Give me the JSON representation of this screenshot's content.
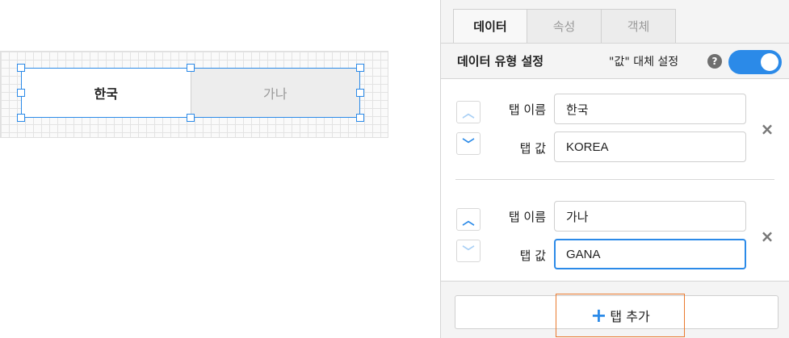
{
  "preview": {
    "tabs": [
      {
        "label": "한국",
        "state": "active"
      },
      {
        "label": "가나",
        "state": "inactive"
      }
    ]
  },
  "panel": {
    "tabs": [
      {
        "label": "데이터",
        "active": true
      },
      {
        "label": "속성",
        "active": false
      },
      {
        "label": "객체",
        "active": false
      }
    ],
    "section_title": "데이터 유형 설정",
    "replace_label": "\"값\" 대체 설정",
    "help_icon": "?",
    "replace_enabled": true,
    "items": [
      {
        "name_label": "탭 이름",
        "value_label": "탭 값",
        "name": "한국",
        "value": "KOREA",
        "up_enabled": false,
        "down_enabled": true
      },
      {
        "name_label": "탭 이름",
        "value_label": "탭 값",
        "name": "가나",
        "value": "GANA",
        "up_enabled": true,
        "down_enabled": false
      }
    ],
    "remove_icon": "×",
    "add_button": {
      "icon": "+",
      "label": "탭 추가"
    }
  },
  "colors": {
    "accent": "#2b8ae8",
    "highlight": "#ea7a2f",
    "panel_bg": "#f4f4f4"
  }
}
